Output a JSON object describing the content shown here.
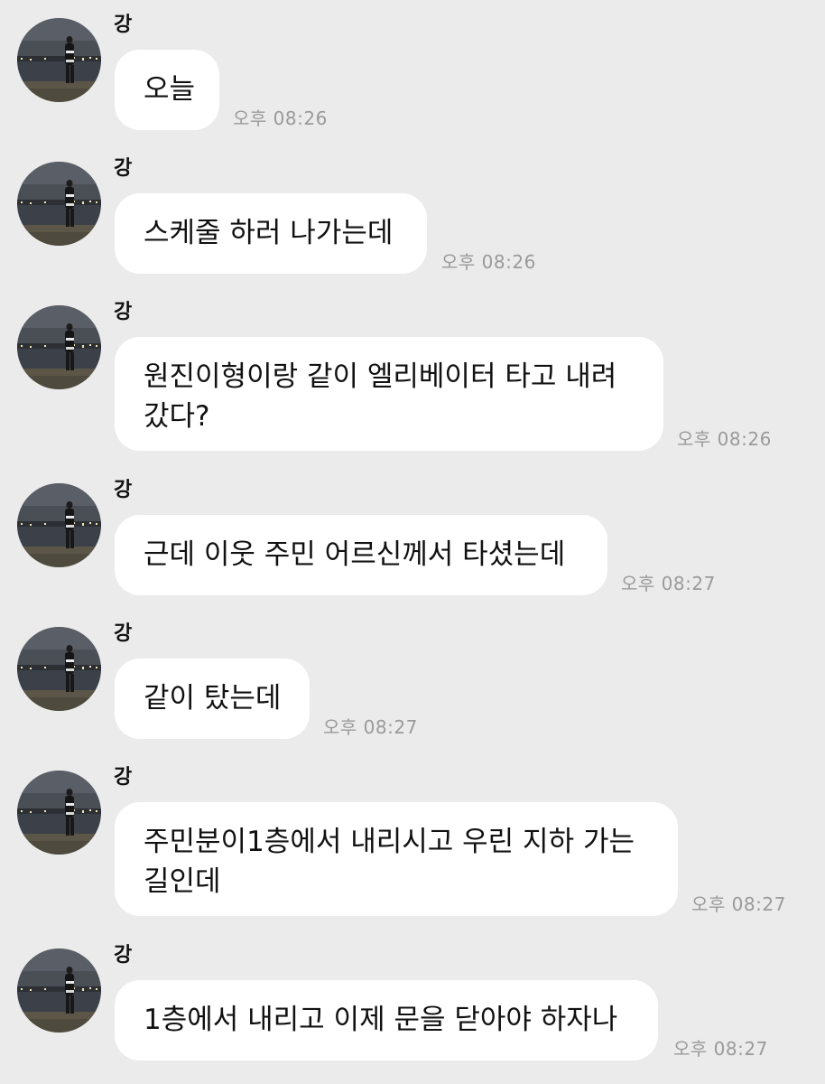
{
  "chat": {
    "colors": {
      "background": "#ebebeb",
      "bubble": "#ffffff",
      "text": "#111111",
      "timestamp": "#9a9a9a"
    },
    "messages": [
      {
        "sender": "강",
        "text": "오늘",
        "time": "오후 08:26"
      },
      {
        "sender": "강",
        "text": "스케줄 하러 나가는데",
        "time": "오후 08:26"
      },
      {
        "sender": "강",
        "text": "원진이형이랑 같이 엘리베이터 타고 내려",
        "text2": "갔다?",
        "time": "오후 08:26"
      },
      {
        "sender": "강",
        "text": "근데 이웃 주민 어르신께서 타셨는데",
        "time": "오후 08:27"
      },
      {
        "sender": "강",
        "text": "같이 탔는데",
        "time": "오후 08:27"
      },
      {
        "sender": "강",
        "text": "주민분이1층에서 내리시고 우린 지하 가는",
        "text2": "길인데",
        "time": "오후 08:27"
      },
      {
        "sender": "강",
        "text": "1층에서 내리고 이제 문을 닫아야 하자나",
        "time": "오후 08:27"
      }
    ]
  }
}
